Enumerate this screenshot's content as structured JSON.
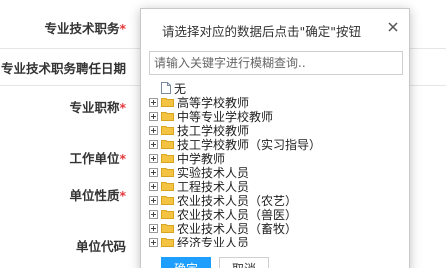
{
  "form": {
    "fields": [
      {
        "label": "专业技术职务",
        "required": true
      },
      {
        "label": "专业技术职务聘任日期",
        "required": false
      },
      {
        "label": "专业职称",
        "required": true
      },
      {
        "label": "工作单位",
        "required": true
      },
      {
        "label": "单位性质",
        "required": true
      },
      {
        "label": "单位代码",
        "required": false
      }
    ],
    "required_mark": "*"
  },
  "dialog": {
    "title": "请选择对应的数据后点击\"确定\"按钮",
    "close_icon": "close-icon",
    "search": {
      "placeholder": "请输入关键字进行模糊查询..",
      "value": ""
    },
    "tree": [
      {
        "label": "无",
        "type": "file",
        "expandable": false
      },
      {
        "label": "高等学校教师",
        "type": "folder",
        "expandable": true
      },
      {
        "label": "中等专业学校教师",
        "type": "folder",
        "expandable": true
      },
      {
        "label": "技工学校教师",
        "type": "folder",
        "expandable": true
      },
      {
        "label": "技工学校教师（实习指导）",
        "type": "folder",
        "expandable": true
      },
      {
        "label": "中学教师",
        "type": "folder",
        "expandable": true
      },
      {
        "label": "实验技术人员",
        "type": "folder",
        "expandable": true
      },
      {
        "label": "工程技术人员",
        "type": "folder",
        "expandable": true
      },
      {
        "label": "农业技术人员（农艺）",
        "type": "folder",
        "expandable": true
      },
      {
        "label": "农业技术人员（兽医）",
        "type": "folder",
        "expandable": true
      },
      {
        "label": "农业技术人员（畜牧）",
        "type": "folder",
        "expandable": true
      },
      {
        "label": "经济专业人员",
        "type": "folder",
        "expandable": true
      }
    ],
    "buttons": {
      "ok": "确定",
      "cancel": "取消"
    }
  },
  "colors": {
    "primary": "#1e9fff",
    "required": "#e4393c",
    "folder": "#f5c342"
  }
}
